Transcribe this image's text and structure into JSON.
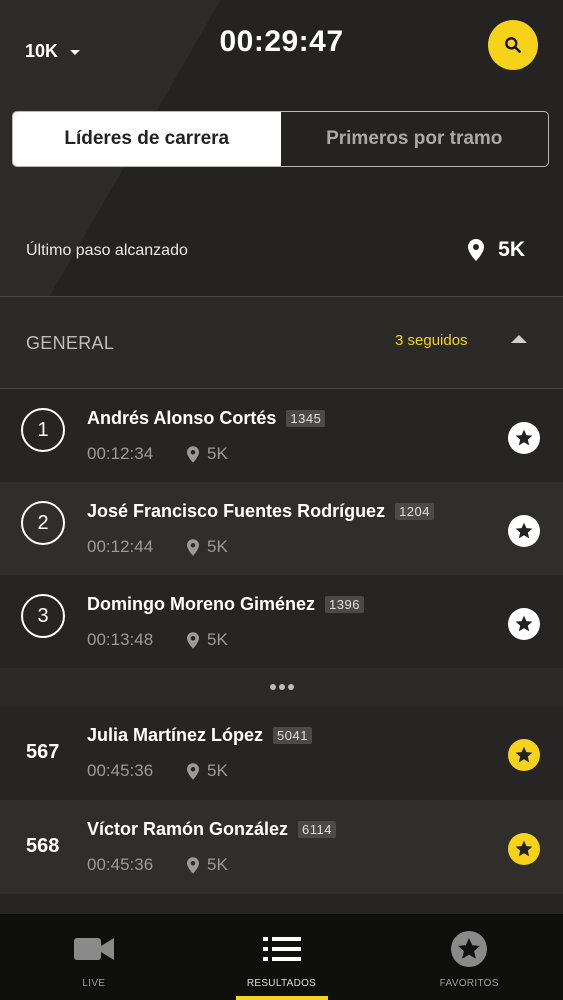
{
  "header": {
    "distance": "10K",
    "timer": "00:29:47",
    "search_icon": "search-icon",
    "accent_color": "#f6d21b"
  },
  "tabs": [
    {
      "label": "Líderes de carrera",
      "active": true
    },
    {
      "label": "Primeros por tramo",
      "active": false
    }
  ],
  "last_step": {
    "label": "Último paso alcanzado",
    "value": "5K"
  },
  "section": {
    "title": "GENERAL",
    "following": "3 seguidos"
  },
  "runners": [
    {
      "rank": "1",
      "name": "Andrés Alonso Cortés",
      "bib": "1345",
      "time": "00:12:34",
      "checkpoint": "5K",
      "favorite": false
    },
    {
      "rank": "2",
      "name": "José Francisco Fuentes Rodríguez",
      "bib": "1204",
      "time": "00:12:44",
      "checkpoint": "5K",
      "favorite": false
    },
    {
      "rank": "3",
      "name": "Domingo Moreno Giménez",
      "bib": "1396",
      "time": "00:13:48",
      "checkpoint": "5K",
      "favorite": false
    },
    {
      "rank": "567",
      "name": "Julia Martínez López",
      "bib": "5041",
      "time": "00:45:36",
      "checkpoint": "5K",
      "favorite": true
    },
    {
      "rank": "568",
      "name": "Víctor Ramón González",
      "bib": "6114",
      "time": "00:45:36",
      "checkpoint": "5K",
      "favorite": true
    }
  ],
  "bottom_nav": [
    {
      "label": "LIVE",
      "icon": "video-camera-icon",
      "active": false
    },
    {
      "label": "RESULTADOS",
      "icon": "list-icon",
      "active": true
    },
    {
      "label": "FAVORITOS",
      "icon": "star-icon",
      "active": false
    }
  ]
}
